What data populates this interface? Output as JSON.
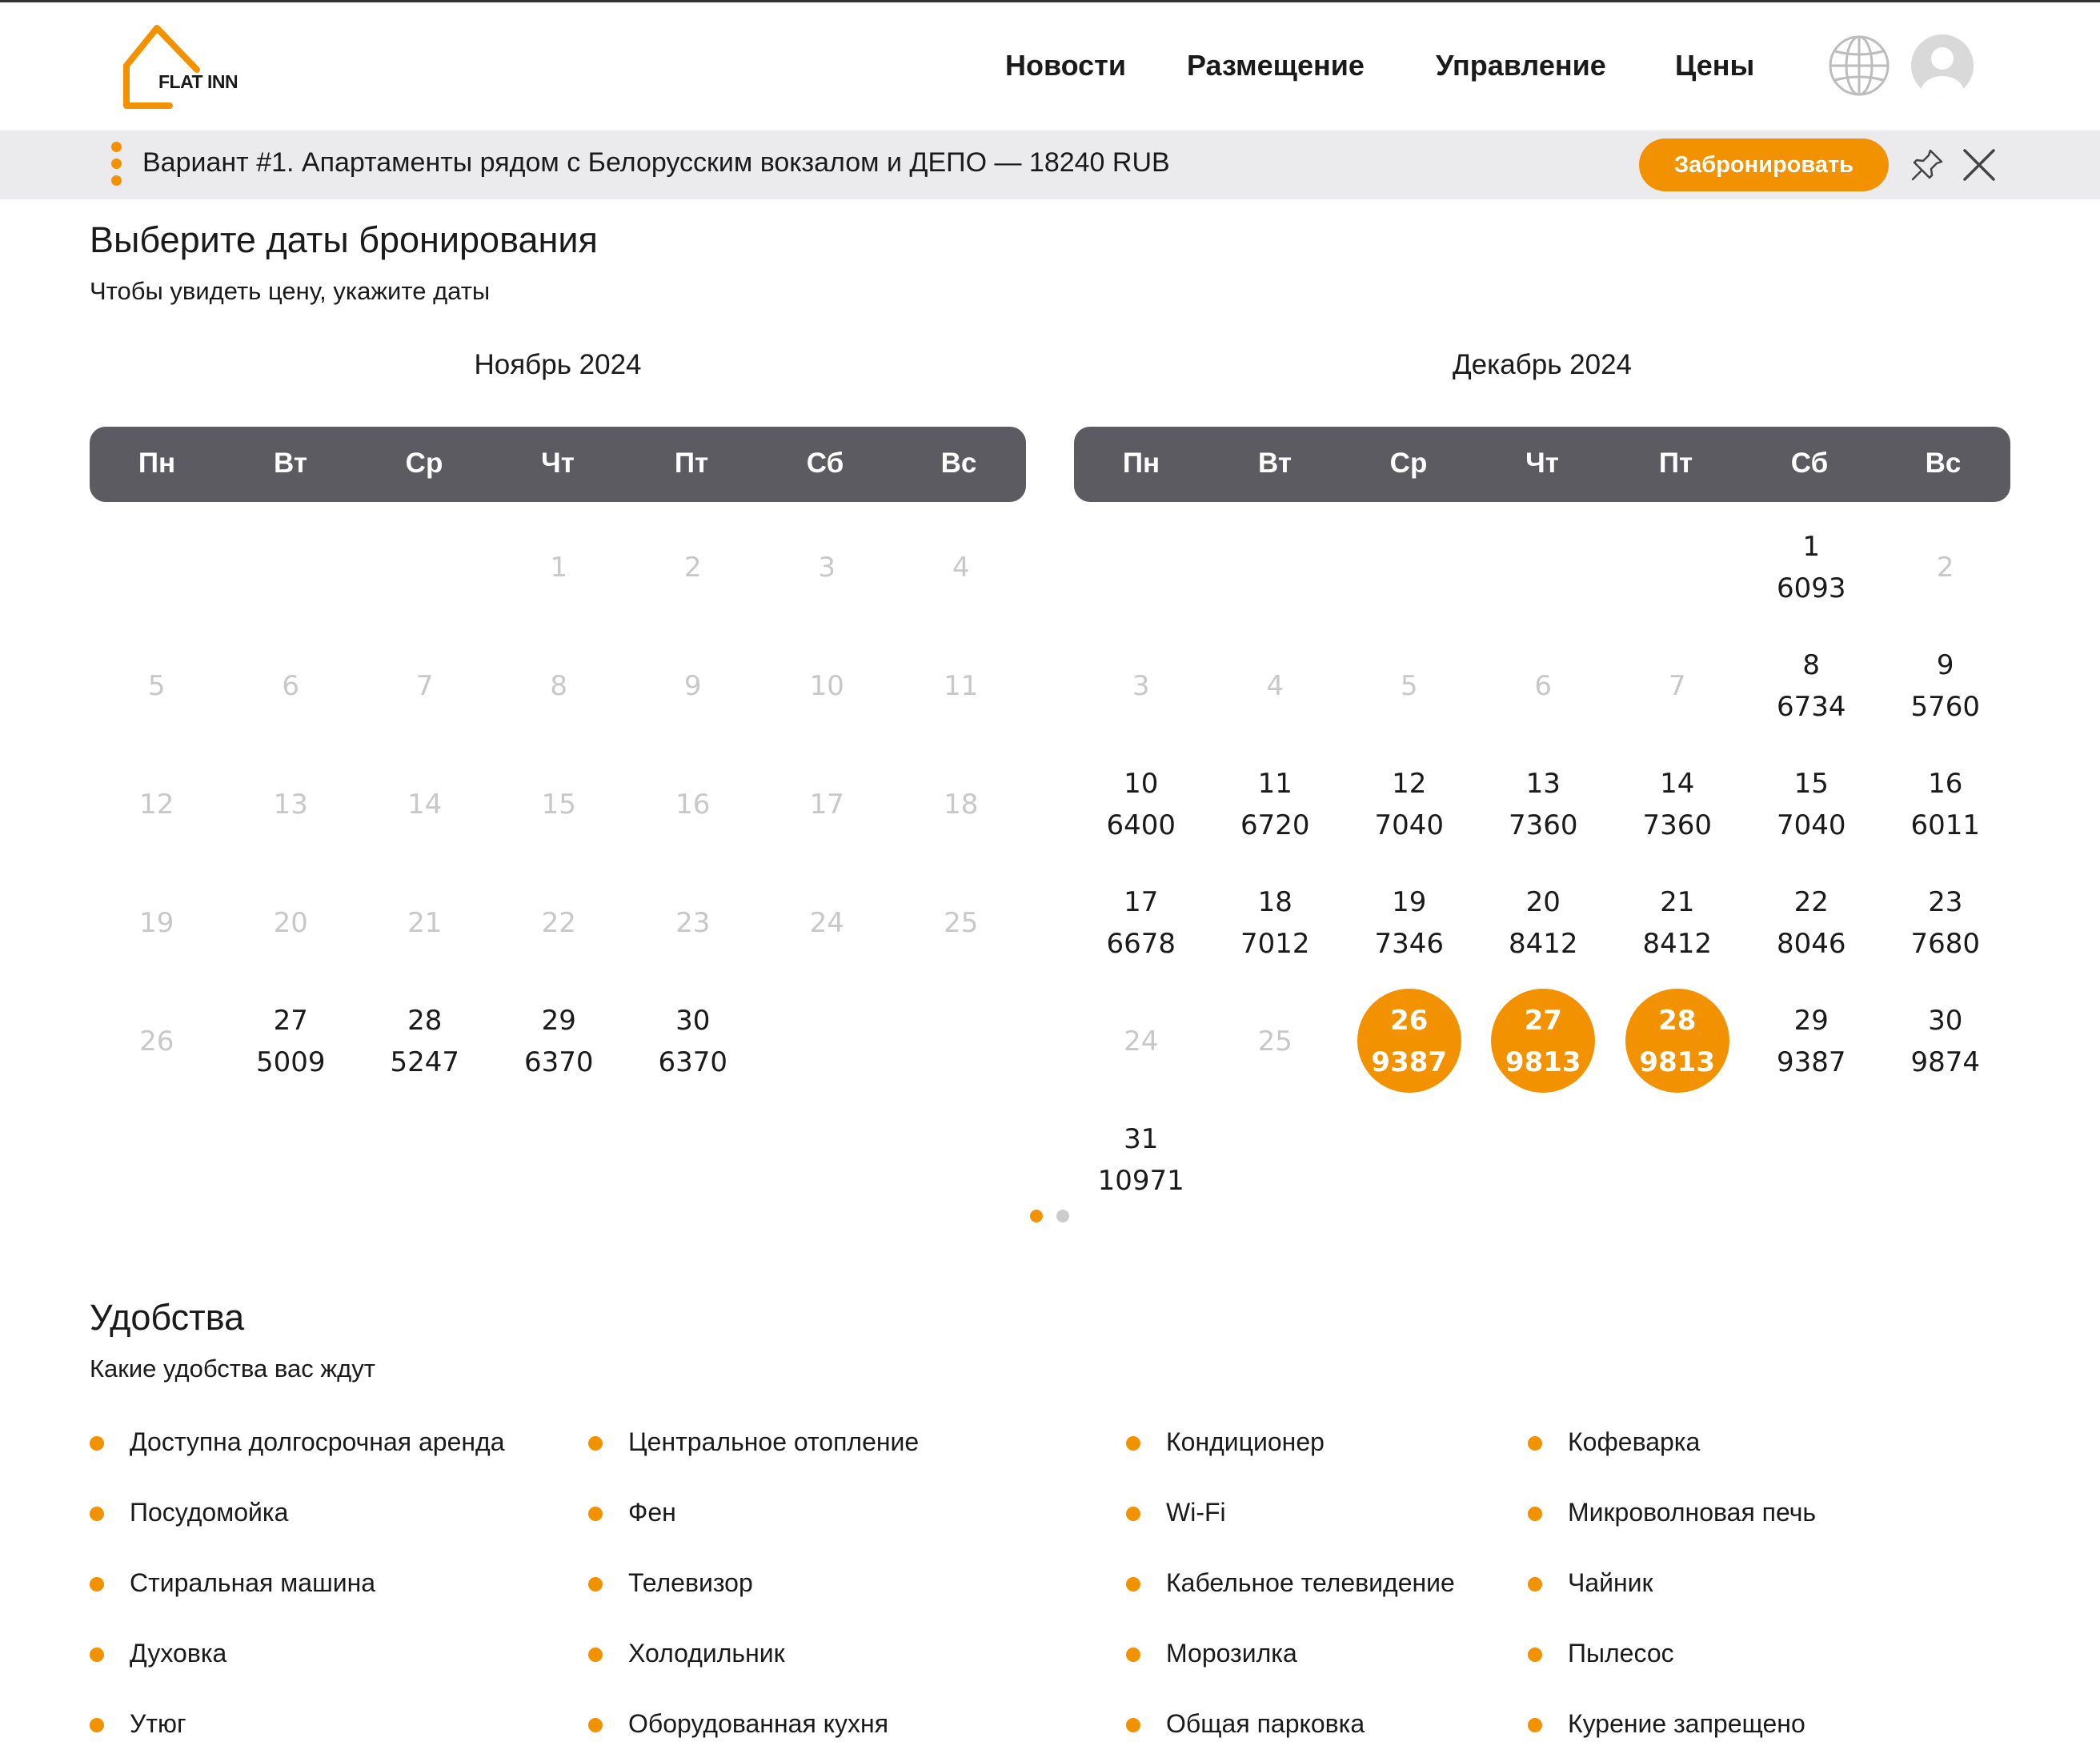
{
  "header": {
    "logo_text": "FLAT INN",
    "nav": [
      "Новости",
      "Размещение",
      "Управление",
      "Цены"
    ],
    "icons": [
      "globe-icon",
      "user-avatar-icon"
    ]
  },
  "bar": {
    "text": "Вариант #1. Апартаменты рядом с Белорусским вокзалом и ДЕПО — 18240 RUB",
    "book_label": "Забронировать",
    "icons": [
      "kebab-menu-icon",
      "pin-icon",
      "close-icon"
    ]
  },
  "booking": {
    "title": "Выберите даты бронирования",
    "subtitle": "Чтобы увидеть цену, укажите даты",
    "weekdays": [
      "Пн",
      "Вт",
      "Ср",
      "Чт",
      "Пт",
      "Сб",
      "Вс"
    ],
    "months": [
      {
        "title": "Ноябрь 2024",
        "first_weekday": 4,
        "days": [
          {
            "d": "1"
          },
          {
            "d": "2"
          },
          {
            "d": "3"
          },
          {
            "d": "4"
          },
          {
            "d": "5"
          },
          {
            "d": "6"
          },
          {
            "d": "7"
          },
          {
            "d": "8"
          },
          {
            "d": "9"
          },
          {
            "d": "10"
          },
          {
            "d": "11"
          },
          {
            "d": "12"
          },
          {
            "d": "13"
          },
          {
            "d": "14"
          },
          {
            "d": "15"
          },
          {
            "d": "16"
          },
          {
            "d": "17"
          },
          {
            "d": "18"
          },
          {
            "d": "19"
          },
          {
            "d": "20"
          },
          {
            "d": "21"
          },
          {
            "d": "22"
          },
          {
            "d": "23"
          },
          {
            "d": "24"
          },
          {
            "d": "25"
          },
          {
            "d": "26"
          },
          {
            "d": "27",
            "p": "5009"
          },
          {
            "d": "28",
            "p": "5247"
          },
          {
            "d": "29",
            "p": "6370"
          },
          {
            "d": "30",
            "p": "6370"
          }
        ]
      },
      {
        "title": "Декабрь 2024",
        "first_weekday": 6,
        "days": [
          {
            "d": "1",
            "p": "6093"
          },
          {
            "d": "2"
          },
          {
            "d": "3"
          },
          {
            "d": "4"
          },
          {
            "d": "5"
          },
          {
            "d": "6"
          },
          {
            "d": "7"
          },
          {
            "d": "8",
            "p": "6734"
          },
          {
            "d": "9",
            "p": "5760"
          },
          {
            "d": "10",
            "p": "6400"
          },
          {
            "d": "11",
            "p": "6720"
          },
          {
            "d": "12",
            "p": "7040"
          },
          {
            "d": "13",
            "p": "7360"
          },
          {
            "d": "14",
            "p": "7360"
          },
          {
            "d": "15",
            "p": "7040"
          },
          {
            "d": "16",
            "p": "6011"
          },
          {
            "d": "17",
            "p": "6678"
          },
          {
            "d": "18",
            "p": "7012"
          },
          {
            "d": "19",
            "p": "7346"
          },
          {
            "d": "20",
            "p": "8412"
          },
          {
            "d": "21",
            "p": "8412"
          },
          {
            "d": "22",
            "p": "8046"
          },
          {
            "d": "23",
            "p": "7680"
          },
          {
            "d": "24"
          },
          {
            "d": "25"
          },
          {
            "d": "26",
            "p": "9387",
            "selected": true
          },
          {
            "d": "27",
            "p": "9813",
            "selected": true
          },
          {
            "d": "28",
            "p": "9813",
            "selected": true
          },
          {
            "d": "29",
            "p": "9387"
          },
          {
            "d": "30",
            "p": "9874"
          },
          {
            "d": "31",
            "p": "10971"
          }
        ]
      }
    ],
    "pagination": {
      "count": 2,
      "active": 0
    }
  },
  "amenities": {
    "title": "Удобства",
    "subtitle": "Какие удобства вас ждут",
    "items": [
      "Доступна долгосрочная аренда",
      "Центральное отопление",
      "Кондиционер",
      "Кофеварка",
      "Посудомойка",
      "Фен",
      "Wi-Fi",
      "Микроволновая печь",
      "Стиральная машина",
      "Телевизор",
      "Кабельное телевидение",
      "Чайник",
      "Духовка",
      "Холодильник",
      "Морозилка",
      "Пылесос",
      "Утюг",
      "Оборудованная кухня",
      "Общая парковка",
      "Курение запрещено"
    ]
  },
  "colors": {
    "accent": "#f39200",
    "weekday_bar": "#5c5b61",
    "info_bar": "#ebebee",
    "disabled_text": "#c8c8c8"
  }
}
